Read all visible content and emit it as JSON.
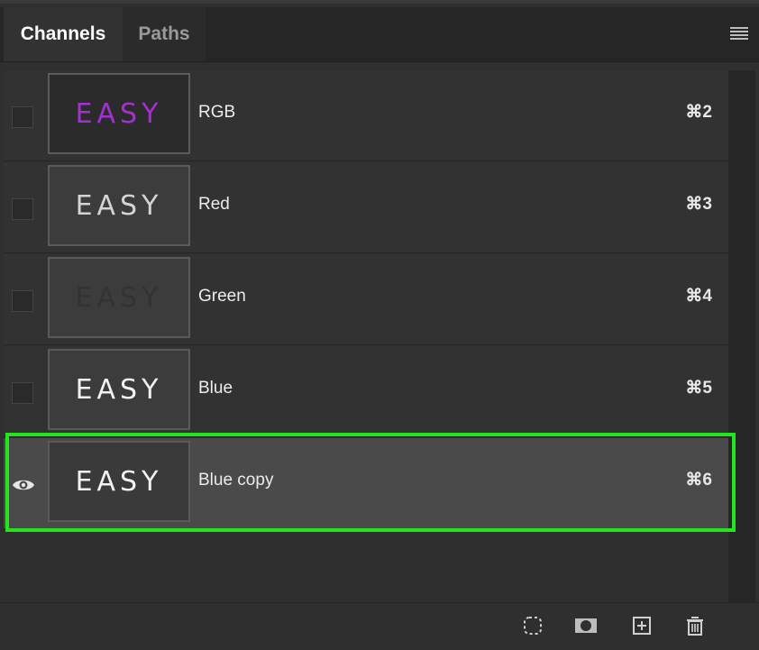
{
  "tabs": [
    {
      "label": "Channels",
      "active": true
    },
    {
      "label": "Paths",
      "active": false
    }
  ],
  "panel_menu_icon": "hamburger-menu-icon",
  "channels": [
    {
      "name": "RGB",
      "shortcut": "⌘2",
      "thumb_text": "EASY",
      "thumb_text_color": "#a52fd3",
      "thumb_bg": "#2b2b2b",
      "visible": false,
      "selected": false
    },
    {
      "name": "Red",
      "shortcut": "⌘3",
      "thumb_text": "EASY",
      "thumb_text_color": "#d4d4d4",
      "thumb_bg": "#3c3c3c",
      "visible": false,
      "selected": false
    },
    {
      "name": "Green",
      "shortcut": "⌘4",
      "thumb_text": "EASY",
      "thumb_text_color": "#333333",
      "thumb_bg": "#3c3c3c",
      "visible": false,
      "selected": false
    },
    {
      "name": "Blue",
      "shortcut": "⌘5",
      "thumb_text": "EASY",
      "thumb_text_color": "#f2f2f2",
      "thumb_bg": "#3c3c3c",
      "visible": false,
      "selected": false
    },
    {
      "name": "Blue copy",
      "shortcut": "⌘6",
      "thumb_text": "EASY",
      "thumb_text_color": "#f2f2f2",
      "thumb_bg": "#3a3a3a",
      "visible": true,
      "selected": true
    }
  ],
  "highlight_color": "#22e41f",
  "bottom_icons": [
    "load-selection-icon",
    "save-selection-mask-icon",
    "new-channel-icon",
    "delete-channel-icon"
  ]
}
